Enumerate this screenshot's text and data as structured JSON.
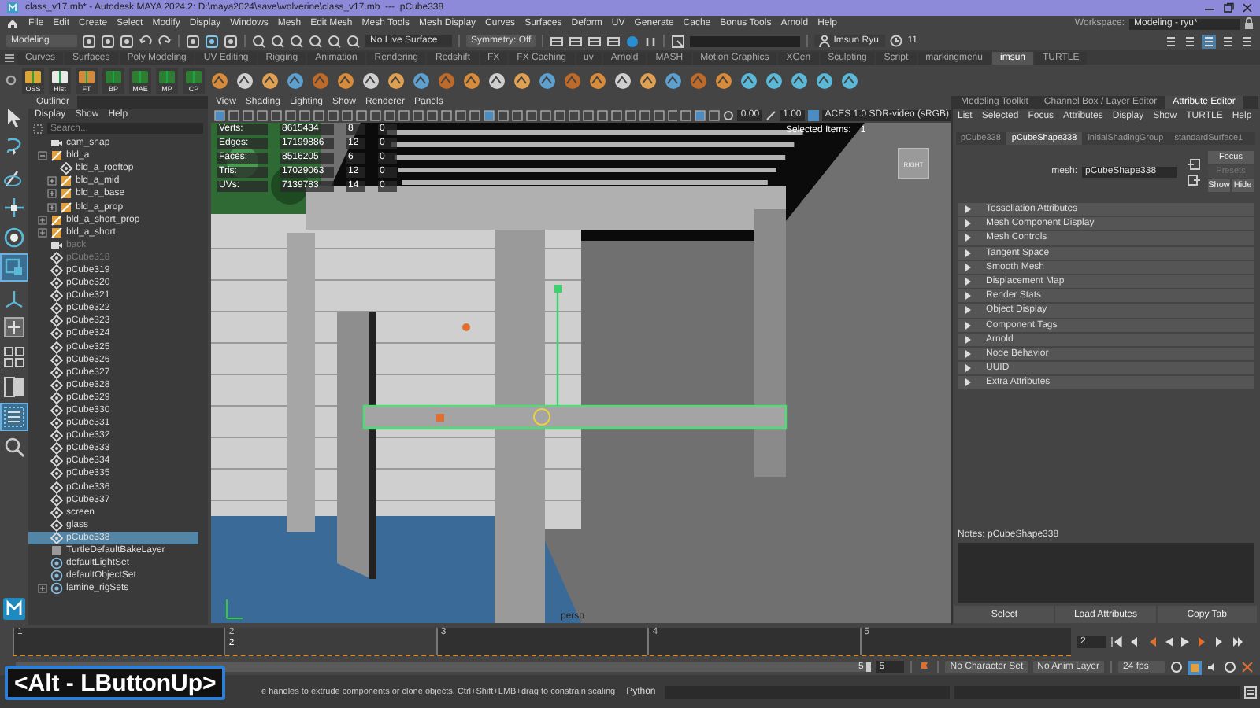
{
  "window": {
    "title": "class_v17.mb* - Autodesk MAYA 2024.2: D:\\maya2024\\save\\wolverine\\class_v17.mb  ---  pCube338"
  },
  "menu_bar": [
    "File",
    "Edit",
    "Create",
    "Select",
    "Modify",
    "Display",
    "Windows",
    "Mesh",
    "Edit Mesh",
    "Mesh Tools",
    "Mesh Display",
    "Curves",
    "Surfaces",
    "Deform",
    "UV",
    "Generate",
    "Cache",
    "Bonus Tools",
    "Arnold",
    "Help"
  ],
  "workspace": {
    "label": "Workspace:",
    "value": "Modeling - ryu*"
  },
  "status_line": {
    "mode": "Modeling",
    "live_surface": "No Live Surface",
    "symmetry": "Symmetry: Off",
    "user": "Imsun Ryu",
    "notifications": "11"
  },
  "shelf_tabs": [
    {
      "label": "Curves",
      "selected": false
    },
    {
      "label": "Surfaces",
      "selected": false
    },
    {
      "label": "Poly Modeling",
      "selected": false
    },
    {
      "label": "UV Editing",
      "selected": false
    },
    {
      "label": "Rigging",
      "selected": false
    },
    {
      "label": "Animation",
      "selected": false
    },
    {
      "label": "Rendering",
      "selected": false
    },
    {
      "label": "Redshift",
      "selected": false
    },
    {
      "label": "FX",
      "selected": false
    },
    {
      "label": "FX Caching",
      "selected": false
    },
    {
      "label": "uv",
      "selected": false
    },
    {
      "label": "Arnold",
      "selected": false
    },
    {
      "label": "MASH",
      "selected": false
    },
    {
      "label": "Motion Graphics",
      "selected": false
    },
    {
      "label": "XGen",
      "selected": false
    },
    {
      "label": "Sculpting",
      "selected": false
    },
    {
      "label": "Script",
      "selected": false
    },
    {
      "label": "markingmenu",
      "selected": false
    },
    {
      "label": "imsun",
      "selected": true
    },
    {
      "label": "TURTLE",
      "selected": false
    }
  ],
  "shelf_tools": [
    "OSS",
    "Hist",
    "FT",
    "BP",
    "MAE",
    "MP",
    "CP"
  ],
  "outliner": {
    "title": "Outliner",
    "menus": [
      "Display",
      "Show",
      "Help"
    ],
    "search": {
      "placeholder": "Search..."
    },
    "items": [
      {
        "label": "cam_snap",
        "kind": "camera",
        "hidden": false,
        "selected": false
      },
      {
        "label": "bld_a",
        "kind": "group",
        "hidden": false,
        "selected": false,
        "expanded": true,
        "children": [
          {
            "label": "bld_a_rooftop",
            "kind": "mesh",
            "hidden": false,
            "selected": false
          },
          {
            "label": "bld_a_mid",
            "kind": "group",
            "hidden": false,
            "selected": false,
            "expanded": false
          },
          {
            "label": "bld_a_base",
            "kind": "group",
            "hidden": false,
            "selected": false,
            "expanded": false
          },
          {
            "label": "bld_a_prop",
            "kind": "group",
            "hidden": false,
            "selected": false,
            "expanded": false
          }
        ]
      },
      {
        "label": "bld_a_short_prop",
        "kind": "group",
        "hidden": false,
        "selected": false,
        "expanded": false
      },
      {
        "label": "bld_a_short",
        "kind": "group",
        "hidden": false,
        "selected": false,
        "expanded": false
      },
      {
        "label": "back",
        "kind": "camera",
        "hidden": true,
        "selected": false
      },
      {
        "label": "pCube318",
        "kind": "mesh",
        "hidden": true,
        "selected": false
      },
      {
        "label": "pCube319",
        "kind": "mesh",
        "hidden": false,
        "selected": false
      },
      {
        "label": "pCube320",
        "kind": "mesh",
        "hidden": false,
        "selected": false
      },
      {
        "label": "pCube321",
        "kind": "mesh",
        "hidden": false,
        "selected": false
      },
      {
        "label": "pCube322",
        "kind": "mesh",
        "hidden": false,
        "selected": false
      },
      {
        "label": "pCube323",
        "kind": "mesh",
        "hidden": false,
        "selected": false
      },
      {
        "label": "pCube324",
        "kind": "mesh",
        "hidden": false,
        "selected": false
      },
      {
        "label": "pCube325",
        "kind": "mesh",
        "hidden": false,
        "selected": false
      },
      {
        "label": "pCube326",
        "kind": "mesh",
        "hidden": false,
        "selected": false
      },
      {
        "label": "pCube327",
        "kind": "mesh",
        "hidden": false,
        "selected": false
      },
      {
        "label": "pCube328",
        "kind": "mesh",
        "hidden": false,
        "selected": false
      },
      {
        "label": "pCube329",
        "kind": "mesh",
        "hidden": false,
        "selected": false
      },
      {
        "label": "pCube330",
        "kind": "mesh",
        "hidden": false,
        "selected": false
      },
      {
        "label": "pCube331",
        "kind": "mesh",
        "hidden": false,
        "selected": false
      },
      {
        "label": "pCube332",
        "kind": "mesh",
        "hidden": false,
        "selected": false
      },
      {
        "label": "pCube333",
        "kind": "mesh",
        "hidden": false,
        "selected": false
      },
      {
        "label": "pCube334",
        "kind": "mesh",
        "hidden": false,
        "selected": false
      },
      {
        "label": "pCube335",
        "kind": "mesh",
        "hidden": false,
        "selected": false
      },
      {
        "label": "pCube336",
        "kind": "mesh",
        "hidden": false,
        "selected": false
      },
      {
        "label": "pCube337",
        "kind": "mesh",
        "hidden": false,
        "selected": false
      },
      {
        "label": "screen",
        "kind": "mesh",
        "hidden": false,
        "selected": false
      },
      {
        "label": "glass",
        "kind": "mesh",
        "hidden": false,
        "selected": false
      },
      {
        "label": "pCube338",
        "kind": "mesh",
        "hidden": false,
        "selected": true
      },
      {
        "label": "TurtleDefaultBakeLayer",
        "kind": "layer",
        "hidden": false,
        "selected": false
      },
      {
        "label": "defaultLightSet",
        "kind": "set",
        "hidden": false,
        "selected": false
      },
      {
        "label": "defaultObjectSet",
        "kind": "set",
        "hidden": false,
        "selected": false
      },
      {
        "label": "lamine_rigSets",
        "kind": "set",
        "hidden": false,
        "selected": false,
        "expanded": false
      }
    ]
  },
  "viewport": {
    "menus": [
      "View",
      "Shading",
      "Lighting",
      "Show",
      "Renderer",
      "Panels"
    ],
    "exposure": "0.00",
    "gamma": "1.00",
    "color_space": "ACES 1.0 SDR-video (sRGB)",
    "stats": [
      {
        "label": "Verts:",
        "total": "8615434",
        "selection": "8",
        "component": "0"
      },
      {
        "label": "Edges:",
        "total": "17199886",
        "selection": "12",
        "component": "0"
      },
      {
        "label": "Faces:",
        "total": "8516205",
        "selection": "6",
        "component": "0"
      },
      {
        "label": "Tris:",
        "total": "17029063",
        "selection": "12",
        "component": "0"
      },
      {
        "label": "UVs:",
        "total": "7139783",
        "selection": "14",
        "component": "0"
      }
    ],
    "selected_items": {
      "label": "Selected Items:",
      "value": "1"
    },
    "view_cube": "RIGHT",
    "camera": "persp"
  },
  "attribute_editor": {
    "panel_tabs": [
      {
        "label": "Modeling Toolkit",
        "selected": false
      },
      {
        "label": "Channel Box / Layer Editor",
        "selected": false
      },
      {
        "label": "Attribute Editor",
        "selected": true
      }
    ],
    "menus": [
      "List",
      "Selected",
      "Focus",
      "Attributes",
      "Display",
      "Show",
      "TURTLE",
      "Help"
    ],
    "node_tabs": [
      {
        "label": "pCube338",
        "selected": false
      },
      {
        "label": "pCubeShape338",
        "selected": true
      },
      {
        "label": "initialShadingGroup",
        "selected": false
      },
      {
        "label": "standardSurface1",
        "selected": false
      }
    ],
    "node_label": "mesh:",
    "node_name": "pCubeShape338",
    "side_buttons": [
      {
        "label": "Focus",
        "disabled": false
      },
      {
        "label": "Presets",
        "disabled": true
      },
      {
        "label": "Show",
        "disabled": false
      },
      {
        "label": "Hide",
        "disabled": false
      }
    ],
    "sections": [
      "Tessellation Attributes",
      "Mesh Component Display",
      "Mesh Controls",
      "Tangent Space",
      "Smooth Mesh",
      "Displacement Map",
      "Render Stats",
      "Object Display",
      "Component Tags",
      "Arnold",
      "Node Behavior",
      "UUID",
      "Extra Attributes"
    ],
    "notes_label": "Notes:  pCubeShape338",
    "buttons": [
      "Select",
      "Load Attributes",
      "Copy Tab"
    ]
  },
  "time_slider": {
    "ticks": [
      {
        "label": "1",
        "selected": false
      },
      {
        "label": "2",
        "selected": true
      },
      {
        "label": "3",
        "selected": false
      },
      {
        "label": "4",
        "selected": false
      },
      {
        "label": "5",
        "selected": false
      }
    ],
    "current_frame": "2",
    "frame_field": "2"
  },
  "range_slider": {
    "level": 1,
    "end_label": "5",
    "end_field": "5",
    "character_set": "No Character Set",
    "anim_layer": "No Anim Layer",
    "fps": "24 fps"
  },
  "help_line": "e handles to extrude components or clone objects. Ctrl+Shift+LMB+drag to constrain scaling",
  "command_line": {
    "language": "Python"
  },
  "key_overlay": "<Alt - LButtonUp>"
}
